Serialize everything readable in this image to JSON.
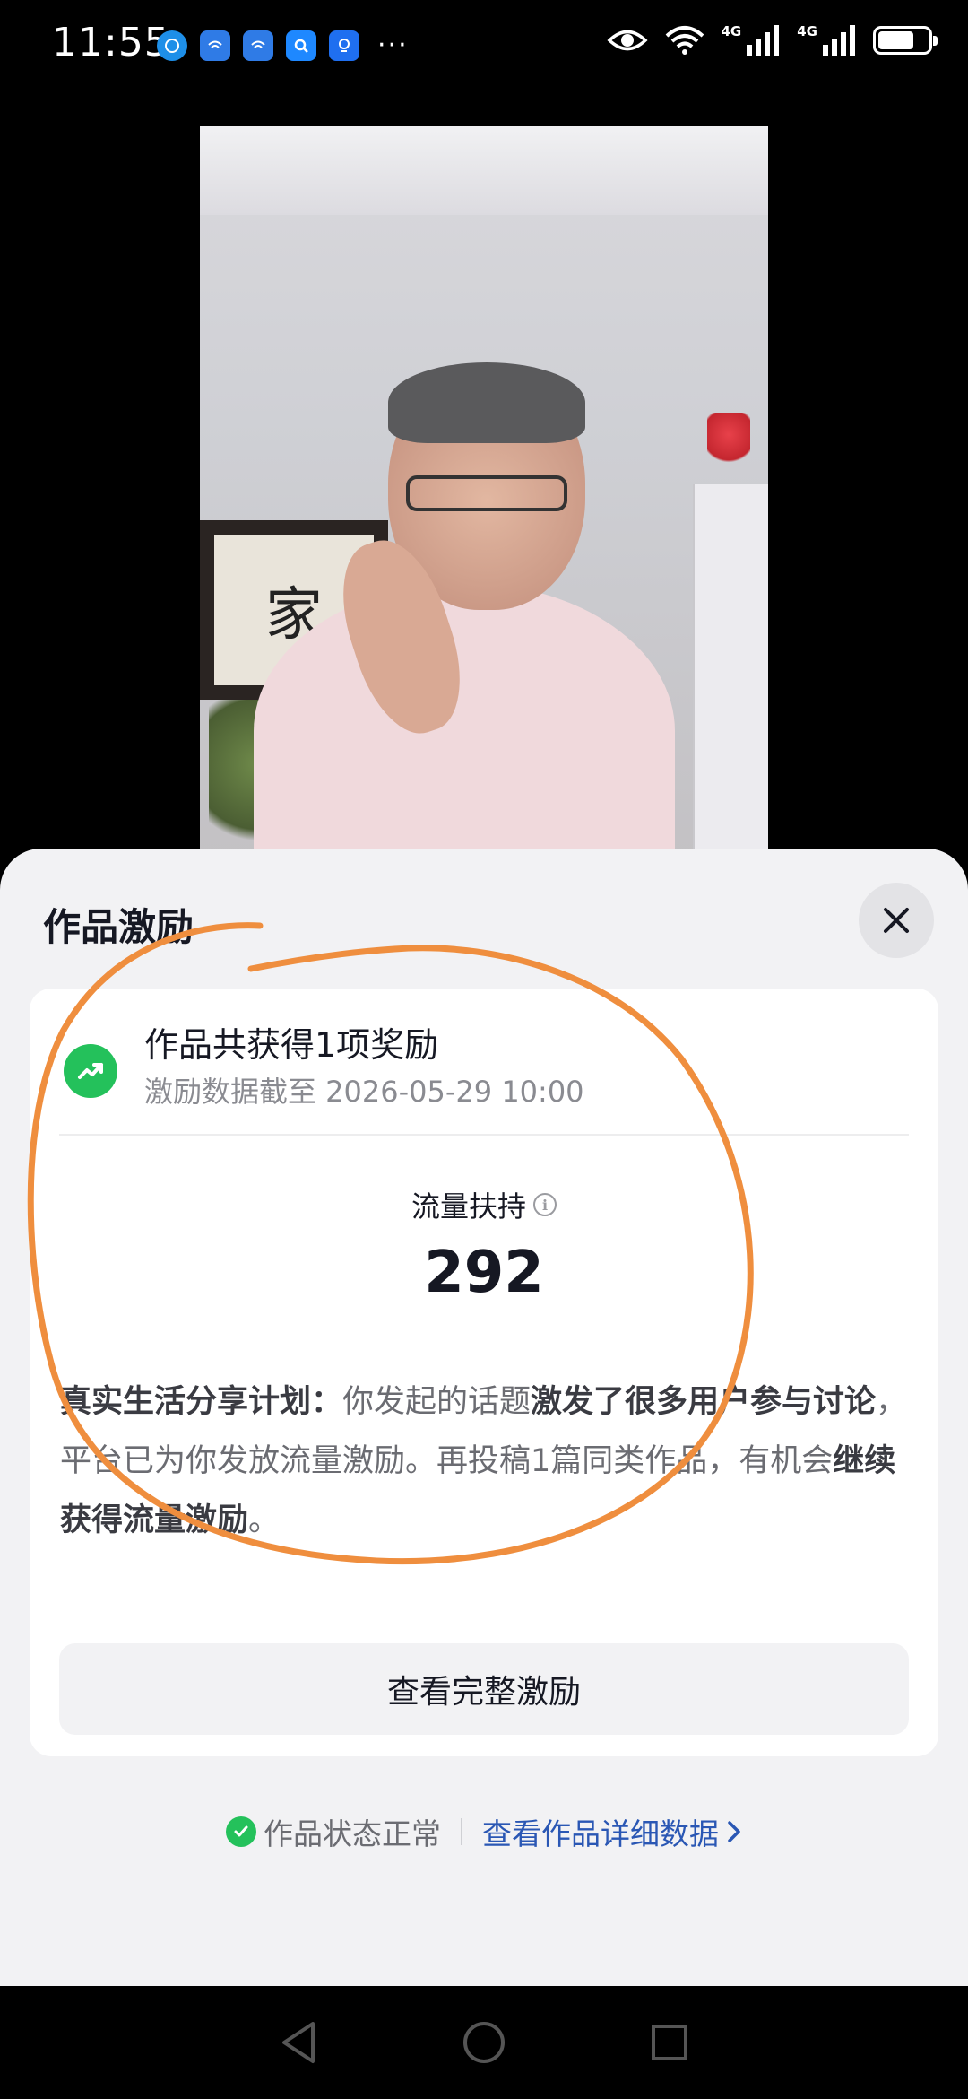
{
  "status_bar": {
    "time": "11:55",
    "more": "···",
    "signal_label_1": "4G",
    "signal_label_2": "4G"
  },
  "sheet": {
    "title": "作品激励",
    "close_label": "×"
  },
  "card": {
    "reward_title": "作品共获得1项奖励",
    "reward_subtitle": "激励数据截至 2026-05-29 10:00",
    "metric_label": "流量扶持",
    "metric_value": "292",
    "desc_bold_1": "真实生活分享计划：",
    "desc_text_1": "你发起的话题",
    "desc_bold_2": "激发了很多用户参与讨论",
    "desc_text_2": "，平台已为你发放流量激励。再投稿1篇同类作品，有机会",
    "desc_bold_3": "继续获得流量激励",
    "desc_text_3": "。",
    "full_button_label": "查看完整激励"
  },
  "footer": {
    "status_text": "作品状态正常",
    "detail_link": "查看作品详细数据"
  },
  "video": {
    "calligraphy_char": "家"
  },
  "colors": {
    "accent_green": "#24c15b",
    "link_blue": "#2a57b4",
    "annotation_orange": "#ef8e3e"
  }
}
